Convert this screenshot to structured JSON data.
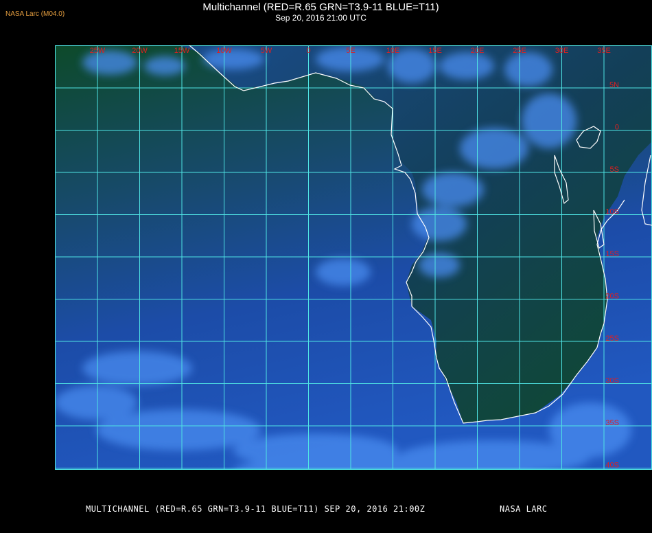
{
  "header": {
    "source_label": "NASA Larc (M04.0)",
    "title": "Multichannel (RED=R.65 GRN=T3.9-11 BLUE=T11)",
    "datetime": "Sep 20, 2016 21:00 UTC"
  },
  "map": {
    "lon_labels": [
      "25W",
      "20W",
      "15W",
      "10W",
      "5W",
      "0",
      "5E",
      "10E",
      "15E",
      "20E",
      "25E",
      "30E",
      "35E"
    ],
    "lat_labels": [
      "5N",
      "0",
      "5S",
      "10S",
      "15S",
      "20S",
      "25S",
      "30S",
      "35S",
      "40S"
    ],
    "colors": {
      "grid": "#4fe4e4",
      "label": "#e02020",
      "coastline": "#ffffff",
      "land": "#0f4a2e",
      "ocean": "#1a48a8",
      "cloud": "#4a8cf0"
    }
  },
  "footer": {
    "caption": "MULTICHANNEL (RED=R.65 GRN=T3.9-11 BLUE=T11) SEP 20, 2016 21:00Z",
    "credit": "NASA LARC"
  }
}
